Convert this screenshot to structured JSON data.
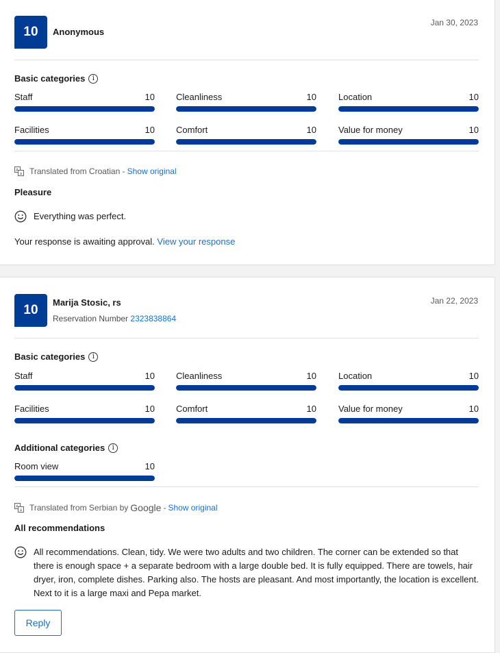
{
  "reviews": [
    {
      "score": "10",
      "name": "Anonymous",
      "date": "Jan 30, 2023",
      "basic_title": "Basic categories",
      "categories": [
        {
          "label": "Staff",
          "value": "10",
          "fill": 1.0
        },
        {
          "label": "Cleanliness",
          "value": "10",
          "fill": 1.0
        },
        {
          "label": "Location",
          "value": "10",
          "fill": 1.0
        },
        {
          "label": "Facilities",
          "value": "10",
          "fill": 1.0
        },
        {
          "label": "Comfort",
          "value": "10",
          "fill": 1.0
        },
        {
          "label": "Value for money",
          "value": "10",
          "fill": 1.0
        }
      ],
      "translated_text": "Translated from Croatian -",
      "show_original": "Show original",
      "review_title": "Pleasure",
      "review_text": "Everything was perfect.",
      "response_text": "Your response is awaiting approval.",
      "response_link": "View your response"
    },
    {
      "score": "10",
      "name": "Marija Stosic, rs",
      "reservation_label": "Reservation Number",
      "reservation_number": "2323838864",
      "date": "Jan 22, 2023",
      "basic_title": "Basic categories",
      "categories": [
        {
          "label": "Staff",
          "value": "10",
          "fill": 1.0
        },
        {
          "label": "Cleanliness",
          "value": "10",
          "fill": 1.0
        },
        {
          "label": "Location",
          "value": "10",
          "fill": 1.0
        },
        {
          "label": "Facilities",
          "value": "10",
          "fill": 1.0
        },
        {
          "label": "Comfort",
          "value": "10",
          "fill": 1.0
        },
        {
          "label": "Value for money",
          "value": "10",
          "fill": 1.0
        }
      ],
      "additional_title": "Additional categories",
      "additional_categories": [
        {
          "label": "Room view",
          "value": "10",
          "fill": 1.0
        }
      ],
      "translated_text": "Translated from Serbian by",
      "translated_brand": "Google",
      "translated_sep": "-",
      "show_original": "Show original",
      "review_title": "All recommendations",
      "review_text": "All recommendations. Clean, tidy. We were two adults and two children. The corner can be extended so that there is enough space + a separate bedroom with a large double bed. It is fully equipped. There are towels, hair dryer, iron, complete dishes. Parking also. The hosts are pleasant. And most importantly, the location is excellent. Next to it is a large maxi and Pepa market.",
      "reply_label": "Reply"
    }
  ],
  "icons": {
    "info": "info-icon",
    "translate": "translate-icon",
    "smile": "smiley-icon"
  },
  "colors": {
    "brand": "#003b95",
    "link": "#1a6fbf"
  }
}
